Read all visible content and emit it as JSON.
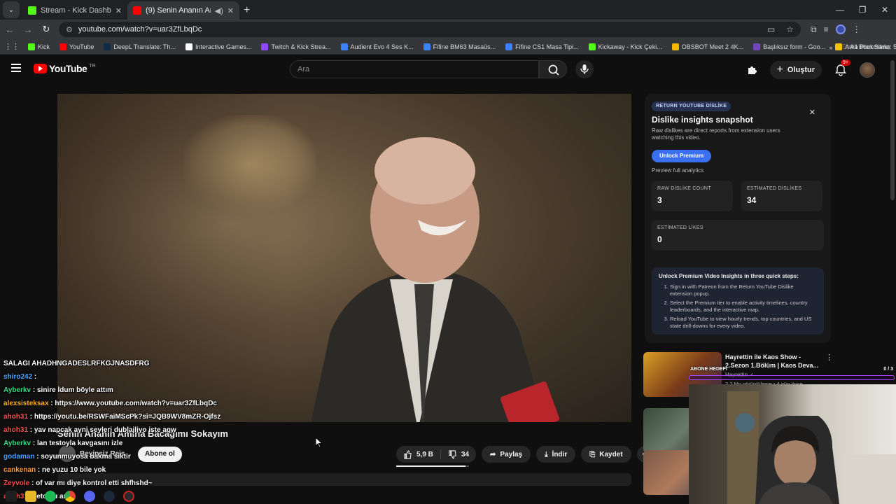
{
  "browser": {
    "tabs": [
      {
        "title": "Stream - Kick Dashboard",
        "active": false,
        "favicon_color": "#53fc18"
      },
      {
        "title": "(9) Senin Ananın Amına Ba...",
        "active": true,
        "favicon_color": "#ff0000"
      }
    ],
    "url": "youtube.com/watch?v=uar3ZfLbqDc",
    "bookmarks": [
      {
        "label": "Kick",
        "color": "#53fc18"
      },
      {
        "label": "YouTube",
        "color": "#ff0000"
      },
      {
        "label": "DeepL Translate: Th...",
        "color": "#0f2b46"
      },
      {
        "label": "Interactive Games...",
        "color": "#ffffff"
      },
      {
        "label": "Twitch & Kick Strea...",
        "color": "#9146ff"
      },
      {
        "label": "Audient Evo 4 Ses K...",
        "color": "#3b82f6"
      },
      {
        "label": "Fifine BM63 Masaüs...",
        "color": "#3b82f6"
      },
      {
        "label": "Fifine CS1 Masa Tipi...",
        "color": "#3b82f6"
      },
      {
        "label": "Kickaway - Kick Çeki...",
        "color": "#53fc18"
      },
      {
        "label": "OBSBOT Meet 2 4K...",
        "color": "#f5b800"
      },
      {
        "label": "Başlıksız form - Goo...",
        "color": "#7248b9"
      },
      {
        "label": "Arka Plan Silme: 5 S...",
        "color": "#f5c400"
      }
    ],
    "all_bookmarks": "All Bookmarks"
  },
  "youtube": {
    "logo_text": "YouTube",
    "logo_country": "TR",
    "search_placeholder": "Ara",
    "create_label": "Oluştur",
    "notif_badge": "9+"
  },
  "video": {
    "title": "Senin Ananın Amına Bacağımı Sokayım",
    "channel": "Beyinsiz Reis",
    "subscribe_label": "Abone ol",
    "likes": "5,9 B",
    "dislikes": "34",
    "like_ratio": 0.95,
    "share_label": "Paylaş",
    "download_label": "İndir",
    "save_label": "Kaydet"
  },
  "chat": [
    {
      "user": "",
      "message": "SALAGI AHADHNGADESLRFKGJNASDFRG",
      "color": "#ffffff"
    },
    {
      "user": "shiro242",
      "message": ":",
      "color": "#4ea3ff"
    },
    {
      "user": "Ayberkv",
      "message": ": sinire İdum böyle attım",
      "color": "#3ddc84"
    },
    {
      "user": "alexsisteksax",
      "message": ": https://www.youtube.com/watch?v=uar3ZfLbqDc",
      "color": "#ffb020"
    },
    {
      "user": "ahoh31",
      "message": ": https://youtu.be/RSWFaiMScPk?si=JQB9WV8mZR-Ojfsz",
      "color": "#ff4d4d"
    },
    {
      "user": "ahoh31",
      "message": ": yav napcak ayni seyleri dublajliyo iste aqw",
      "color": "#ff4d4d"
    },
    {
      "user": "Ayberkv",
      "message": ": lan testoyla kavgasını izle",
      "color": "#3ddc84"
    },
    {
      "user": "godaman",
      "message": ": soyunmuyosa bakma siktir",
      "color": "#4ea3ff"
    },
    {
      "user": "cankenan",
      "message": ": ne yuzu 10 bile yok",
      "color": "#ff9a3c"
    },
    {
      "user": "Zeyvole",
      "message": ": of var mı diye kontrol etti shfhshd~",
      "color": "#ff4d4d"
    },
    {
      "user": "ahoh31",
      "message": ": feto bu amk",
      "color": "#ff4d4d"
    }
  ],
  "dislike_panel": {
    "tag": "RETURN YOUTUBE DİSLİKE",
    "title": "Dislike insights snapshot",
    "subtitle": "Raw dislikes are direct reports from extension users watching this video.",
    "unlock_label": "Unlock Premium",
    "preview_label": "Preview full analytics",
    "stats": [
      {
        "label": "RAW DİSLİKE COUNT",
        "value": "3"
      },
      {
        "label": "ESTİMATED DİSLİKES",
        "value": "34"
      },
      {
        "label": "ESTİMATED LİKES",
        "value": "0"
      }
    ],
    "steps_title": "Unlock Premium Video Insights in three quick steps:",
    "steps": [
      "Sign in with Patreon from the Return YouTube Dislike extension popup.",
      "Select the Premium tier to enable activity timelines, country leaderboards, and the interactive map.",
      "Reload YouTube to view hourly trends, top countries, and US state drill-downs for every video."
    ]
  },
  "recommendation": {
    "title": "Hayrettin ile Kaos Show - 2.Sezon 1.Bölüm | Kaos Deva...",
    "channel": "Hayrettin ✓",
    "views": "2,2 Mn görüntüleme • 4 gün önce"
  },
  "subgoal": {
    "label": "ABONE HEDEFİ",
    "count": "0 / 3"
  }
}
